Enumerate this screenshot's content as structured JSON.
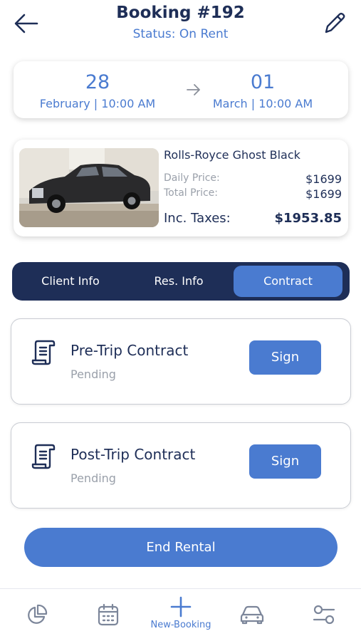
{
  "header": {
    "title": "Booking #192",
    "status": "Status: On Rent"
  },
  "dates": {
    "start_day": "28",
    "start_sub": "February | 10:00 AM",
    "end_day": "01",
    "end_sub": "March | 10:00 AM"
  },
  "car": {
    "name": "Rolls-Royce Ghost Black",
    "daily_label": "Daily Price:",
    "daily_value": "$1699",
    "total_label": "Total Price:",
    "total_value": "$1699",
    "tax_label": "Inc. Taxes:",
    "tax_value": "$1953.85"
  },
  "tabs": [
    {
      "label": "Client Info",
      "active": false
    },
    {
      "label": "Res. Info",
      "active": false
    },
    {
      "label": "Contract",
      "active": true
    }
  ],
  "contracts": [
    {
      "title": "Pre-Trip Contract",
      "status": "Pending",
      "button": "Sign"
    },
    {
      "title": "Post-Trip Contract",
      "status": "Pending",
      "button": "Sign"
    }
  ],
  "end_rental_label": "End Rental",
  "bottom_nav": {
    "items": [
      {
        "icon": "pie-chart-icon"
      },
      {
        "icon": "calendar-icon"
      },
      {
        "icon": "plus-icon",
        "label": "New-Booking"
      },
      {
        "icon": "car-icon"
      },
      {
        "icon": "sliders-icon"
      }
    ]
  },
  "colors": {
    "primary": "#4a7bd0",
    "navy": "#1e2e57",
    "muted": "#9aa0aa"
  }
}
